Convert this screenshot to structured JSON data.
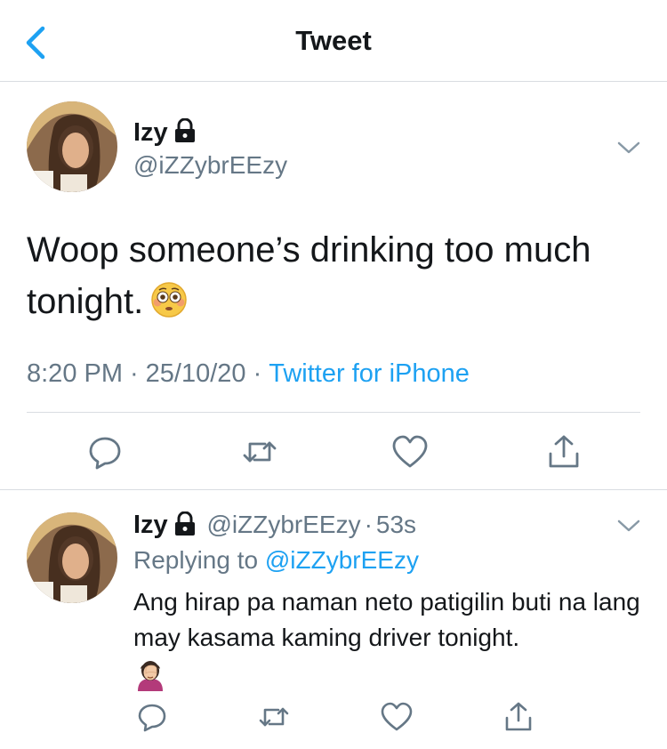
{
  "navbar": {
    "title": "Tweet",
    "back_icon": "chevron-left-icon"
  },
  "colors": {
    "accent": "#1da1f2",
    "secondary_text": "#657786",
    "primary_text": "#14171a",
    "divider": "#d9dde1"
  },
  "tweet": {
    "name": "Izy",
    "handle": "@iZZybrEEzy",
    "text": "Woop someone’s drinking too much tonight.",
    "emoji": "flushed-face-emoji",
    "time": "8:20 PM",
    "date": "25/10/20",
    "separator": "·",
    "client": "Twitter for iPhone",
    "actions": [
      "reply-icon",
      "retweet-icon",
      "like-icon",
      "share-icon"
    ]
  },
  "reply": {
    "name": "Izy",
    "handle": "@iZZybrEEzy",
    "separator": "·",
    "age": "53s",
    "replying_prefix": "Replying to",
    "replying_to": "@iZZybrEEzy",
    "text": "Ang hirap pa naman neto patigilin buti na lang may kasama kaming driver tonight.",
    "emoji": "woman-facepalming-emoji",
    "actions": [
      "reply-icon",
      "retweet-icon",
      "like-icon",
      "share-icon"
    ]
  }
}
